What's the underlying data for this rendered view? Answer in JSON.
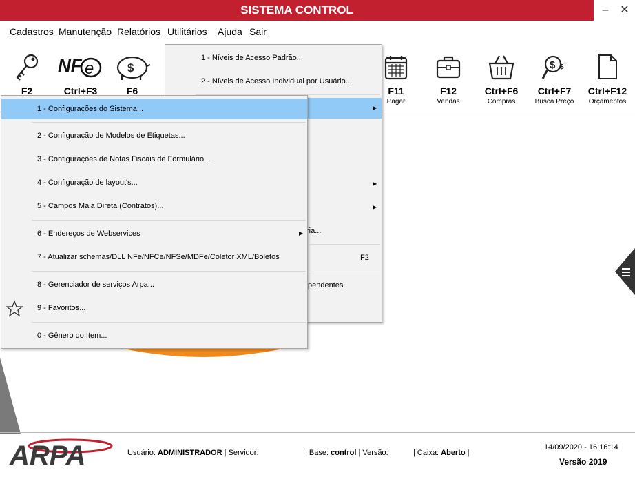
{
  "window": {
    "title": "SISTEMA CONTROL",
    "minimize": "–",
    "close": "✕"
  },
  "menubar": [
    "Cadastros",
    "Manutenção",
    "Relatórios",
    "Utilitários",
    "Ajuda",
    "Sair"
  ],
  "toolbar": [
    {
      "key": "F2",
      "label": "",
      "icon": "key-icon"
    },
    {
      "key": "Ctrl+F3",
      "label": "",
      "icon": "nfe-icon"
    },
    {
      "key": "F6",
      "label": "",
      "icon": "piggy-bank-icon"
    },
    {
      "key": "F11",
      "label": "Pagar",
      "icon": "calendar-icon"
    },
    {
      "key": "F12",
      "label": "Vendas",
      "icon": "briefcase-icon"
    },
    {
      "key": "Ctrl+F6",
      "label": "Compras",
      "icon": "basket-icon"
    },
    {
      "key": "Ctrl+F7",
      "label": "Busca Preço",
      "icon": "price-search-icon"
    },
    {
      "key": "Ctrl+F12",
      "label": "Orçamentos",
      "icon": "document-icon"
    }
  ],
  "utilities_menu": {
    "items": [
      "1 - Níveis de Acesso Padrão...",
      "2 - Níveis de Acesso Individual por Usuário...",
      "ria...",
      "F2",
      "pendentes"
    ]
  },
  "config_menu": {
    "items": [
      "1 - Configurações do Sistema...",
      "2 - Configuração de Modelos de Etiquetas...",
      "3 - Configurações de Notas Fiscais de Formulário...",
      "4 - Configuração de layout's...",
      "5 - Campos Mala Direta (Contratos)...",
      "6 - Endereços de Webservices",
      "7 - Atualizar schemas/DLL NFe/NFCe/NFSe/MDFe/Coletor XML/Boletos",
      "8 - Gerenciador de serviços Arpa...",
      "9 - Favoritos...",
      "0 - Gênero do Item..."
    ]
  },
  "statusbar": {
    "logo": "ARPA",
    "user_label": "Usuário:",
    "user": "ADMINISTRADOR",
    "server_label": "| Servidor:",
    "base_label": "| Base:",
    "base": "control",
    "version_label": "| Versão:",
    "cash_label": "| Caixa:",
    "cash": "Aberto",
    "cash_end": "|",
    "datetime": "14/09/2020 - 16:16:14",
    "app_version": "Versão 2019"
  },
  "colors": {
    "brand_red": "#c21f2f",
    "highlight": "#91c9f7",
    "accent_orange": "#f08a1c"
  }
}
